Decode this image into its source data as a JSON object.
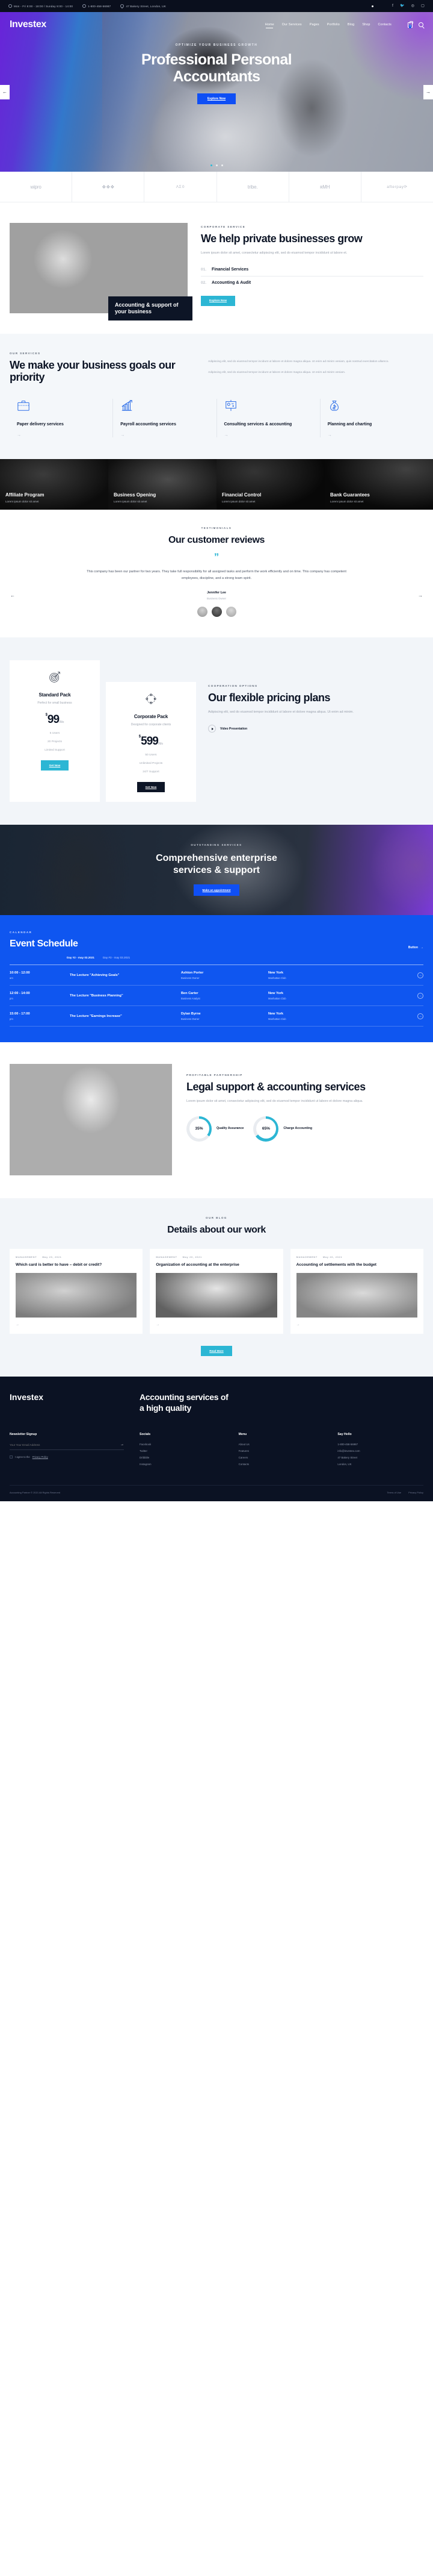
{
  "topbar": {
    "hours": "Mon - Fri 8:00 - 18:00 / Sunday 8:00 - 14:00",
    "phone": "1-800-458-56987",
    "address": "47 Bakery Street, London, UK",
    "social": [
      "facebook-icon",
      "twitter-icon",
      "dribbble-icon",
      "instagram-icon"
    ]
  },
  "header": {
    "brand": "Investex",
    "nav": [
      "Home",
      "Our Services",
      "Pages",
      "Portfolio",
      "Blog",
      "Shop",
      "Contacts"
    ],
    "active_nav": "Home",
    "cart_count": "0"
  },
  "hero": {
    "kicker": "OPTIMIZE YOUR BUSINESS GROWTH",
    "title_line1": "Professional Personal",
    "title_line2": "Accountants",
    "button": "Explore Now",
    "prev": "←",
    "next": "→",
    "dots": 3,
    "active_dot": 0
  },
  "brands": [
    {
      "name": "wipro",
      "style": "normal"
    },
    {
      "name": "❖❖❖",
      "style": "normal"
    },
    {
      "name": "ΛΣ΢0",
      "style": "sm"
    },
    {
      "name": "tribe.",
      "style": "normal"
    },
    {
      "name": "ʀΜΗ",
      "style": "normal"
    },
    {
      "name": "afterpay⟳",
      "style": "sm"
    }
  ],
  "grow": {
    "kicker": "CORPORATE SERVICE",
    "title": "We help private businesses grow",
    "lead": "Lorem ipsum dolor sit amet, consectetur adipiscing elit, sed do eiusmod tempor incididunt ut labore et.",
    "items": [
      {
        "num": "01.",
        "label": "Financial Services"
      },
      {
        "num": "02.",
        "label": "Accounting & Audit"
      }
    ],
    "button": "Explore Now",
    "overlay_title": "Accounting & support of your business"
  },
  "services": {
    "kicker": "OUR SERVICES",
    "title": "We make your business goals our priority",
    "paragraph1": "Adipiscing elit, sed do eiusmod tempor incidunt ut labore et dolore magna aliqua. Ut enim ad minim veniam, quis nostrud exercitation ullamco.",
    "paragraph2": "Adipiscing elit, sed do eiusmod tempor incidunt ut labore et dolore magna aliqua. Ut enim ad minim veniam.",
    "cards": [
      {
        "icon": "briefcase-icon",
        "title": "Paper delivery services",
        "arrow": "→"
      },
      {
        "icon": "growth-chart-icon",
        "title": "Payroll accounting services",
        "arrow": "→"
      },
      {
        "icon": "presentation-board-icon",
        "title": "Consulting services & accounting",
        "arrow": "→"
      },
      {
        "icon": "money-bag-icon",
        "title": "Planning and charting",
        "arrow": "→"
      }
    ]
  },
  "dark_cards": [
    {
      "title": "Affiliate Program",
      "sub": "Lorem ipsum dolor sit amet"
    },
    {
      "title": "Business Opening",
      "sub": "Lorem ipsum dolor sit amet"
    },
    {
      "title": "Financial Control",
      "sub": "Lorem ipsum dolor sit amet"
    },
    {
      "title": "Bank Guarantees",
      "sub": "Lorem ipsum dolor sit amet"
    }
  ],
  "testimonials": {
    "kicker": "TESTIMONIALS",
    "title": "Our customer reviews",
    "quote_mark": "”",
    "body": "This company has been our partner for two years. They take full responsibility for all assigned tasks and perform the work efficiently and on time. This company has competent employees, discipline, and a strong team spirit.",
    "name": "Jennifer Lee",
    "role": "Business Owner",
    "prev": "←",
    "next": "→"
  },
  "pricing": {
    "kicker": "COOPERATION OPTIONS",
    "title": "Our flexible pricing plans",
    "lead": "Adipiscing elit, sed do eiusmod tempor incididunt ut labore et dolore magna aliqua. Ut enim ad minim.",
    "video_label": "Video Presentation",
    "plans": [
      {
        "icon": "target-icon",
        "name": "Standard Pack",
        "sub": "Perfect for small business",
        "currency": "$",
        "amount": "99",
        "per": "/Mo",
        "features": [
          "5 Users",
          "20 Projects",
          "Limited Support"
        ],
        "button": "Get Now"
      },
      {
        "icon": "network-icon",
        "name": "Corporate Pack",
        "sub": "Designed for corporate clients",
        "currency": "$",
        "amount": "599",
        "per": "/Mo",
        "features": [
          "50 Users",
          "Unlimited Projects",
          "24/7 Support"
        ],
        "button": "Get Now"
      }
    ]
  },
  "cta": {
    "kicker": "OUTSTANDING SERVICES",
    "title_line1": "Comprehensive enterprise",
    "title_line2": "services & support",
    "button": "Make an appointment"
  },
  "event": {
    "kicker": "CALENDAR",
    "title": "Event Schedule",
    "button": "Button",
    "button_arrow": "→",
    "tabs": [
      "Day #2 - may 02.2021",
      "Day #3 - may 03.2021"
    ],
    "rows": [
      {
        "time": "10:00 - 12:00",
        "meridiem": "am",
        "lecture": "The Lecture \"Achieving Goals\"",
        "speaker": "Ashton Porter",
        "speaker_role": "Business Owner",
        "city": "New York",
        "venue": "Manhattan Club",
        "arrow": "→"
      },
      {
        "time": "12:00 - 14:00",
        "meridiem": "pm",
        "lecture": "The Lecture \"Business Planning\"",
        "speaker": "Ben Carter",
        "speaker_role": "Business Analyst",
        "city": "New York",
        "venue": "Manhattan Club",
        "arrow": "→"
      },
      {
        "time": "15:00 - 17:00",
        "meridiem": "pm",
        "lecture": "The Lecture \"Earnings Increase\"",
        "speaker": "Dylan Byrne",
        "speaker_role": "Business Owner",
        "city": "New York",
        "venue": "Manhattan Club",
        "arrow": "→"
      }
    ]
  },
  "legal": {
    "kicker": "PROFITABLE PARTNERSHIP",
    "title": "Legal support & accounting services",
    "lead": "Lorem ipsum dolor sit amet, consectetur adipiscing elit, sed do eiusmod tempor incididunt ut labore et dolore magna aliqua.",
    "stats": [
      {
        "value": "35%",
        "label": "Quality Assurance",
        "percent": 35
      },
      {
        "value": "65%",
        "label": "Charge Accounting",
        "percent": 65
      }
    ]
  },
  "blog": {
    "kicker": "OUR BLOG",
    "title": "Details about our work",
    "posts": [
      {
        "category": "MANAGEMENT",
        "date": "May 20, 2021",
        "title": "Which card is better to have – debit or credit?",
        "arrow": "→"
      },
      {
        "category": "MANAGEMENT",
        "date": "May 20, 2021",
        "title": "Organization of accounting at the enterprise",
        "arrow": "→"
      },
      {
        "category": "MANAGEMENT",
        "date": "May 20, 2021",
        "title": "Accounting of settlements with the budget",
        "arrow": "→"
      }
    ],
    "button": "Read More"
  },
  "footer": {
    "brand": "Investex",
    "claim_line1": "Accounting services of",
    "claim_line2": "a high quality",
    "newsletter": {
      "heading": "Newsletter Signup",
      "placeholder": "Your Your Email Address",
      "submit": "→",
      "consent_prefix": "I agree to the",
      "consent_link": "Privacy Policy"
    },
    "columns": [
      {
        "heading": "Socials",
        "links": [
          "Facebook",
          "Twitter",
          "Dribbble",
          "Instagram"
        ]
      },
      {
        "heading": "Menu",
        "links": [
          "About Us",
          "Features",
          "Careers",
          "Contacts"
        ]
      },
      {
        "heading": "Say Hello",
        "links": [
          "1-800-458-56987",
          "info@investex.com",
          "47 Bakery Street",
          "London, UK"
        ]
      }
    ],
    "copyright": "Accounting Partner © 2021 All Rights Reserved",
    "bottom_links": [
      "Terms of Use",
      "Privacy Policy"
    ]
  }
}
